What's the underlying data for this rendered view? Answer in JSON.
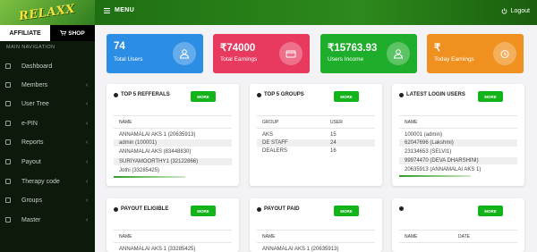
{
  "app": {
    "logo_text": "RELAXX"
  },
  "sidebar": {
    "tab_affiliate": "AFFILIATE",
    "tab_shop": "SHOP",
    "nav_title": "MAIN NAVIGATION",
    "items": [
      {
        "label": "Dashboard"
      },
      {
        "label": "Members"
      },
      {
        "label": "User Tree"
      },
      {
        "label": "e-PIN"
      },
      {
        "label": "Reports"
      },
      {
        "label": "Payout"
      },
      {
        "label": "Therapy code"
      },
      {
        "label": "Groups"
      },
      {
        "label": "Master"
      }
    ]
  },
  "header": {
    "menu": "MENU",
    "logout": "Logout"
  },
  "stats": [
    {
      "value": "74",
      "label": "Total Users",
      "color": "#2b8de4"
    },
    {
      "value": "₹74000",
      "label": "Total Earnings",
      "color": "#e8395f"
    },
    {
      "value": "₹15763.93",
      "label": "Users Income",
      "color": "#1fae2c"
    },
    {
      "value": "₹",
      "label": "Today Earnings",
      "color": "#f0901f"
    }
  ],
  "panels": {
    "referrals": {
      "title": "TOP 5 REFFERALS",
      "more": "MORE",
      "col_name": "NAME",
      "rows": [
        "ANNAMALAI AKS 1 (20635913)",
        "admin (100001)",
        "ANNAMALAI AKS (83448830)",
        "SURIYAMOORTHY1 (32122866)",
        "Jothi (33285425)"
      ]
    },
    "groups": {
      "title": "TOP 5 GROUPS",
      "more": "MORE",
      "col_group": "GROUP",
      "col_user": "USER",
      "rows": [
        {
          "group": "AKS",
          "user": "15"
        },
        {
          "group": "DE STAFF",
          "user": "24"
        },
        {
          "group": "DEALERS",
          "user": "16"
        }
      ]
    },
    "logins": {
      "title": "LATEST LOGIN USERS",
      "more": "MORE",
      "col_name": "NAME",
      "rows": [
        "100001 (admin)",
        "62047696 (Lakshmi)",
        "23134653 (SELVI1)",
        "99974470 (DEVA DHARSHINI)",
        "20635913 (ANNAMALAI AKS 1)"
      ]
    },
    "payout_eligible": {
      "title": "PAYOUT ELIGIBLE",
      "more": "MORE",
      "col_name": "NAME",
      "rows": [
        "ANNAMALAI AKS 1 (33285425)"
      ]
    },
    "payout_paid": {
      "title": "PAYOUT PAID",
      "more": "MORE",
      "col_name": "NAME",
      "rows": [
        "ANNAMALAI AKS 1 (20635913)"
      ]
    },
    "blank": {
      "more": "MORE",
      "col_name": "NAME",
      "col_date": "DATE"
    }
  }
}
